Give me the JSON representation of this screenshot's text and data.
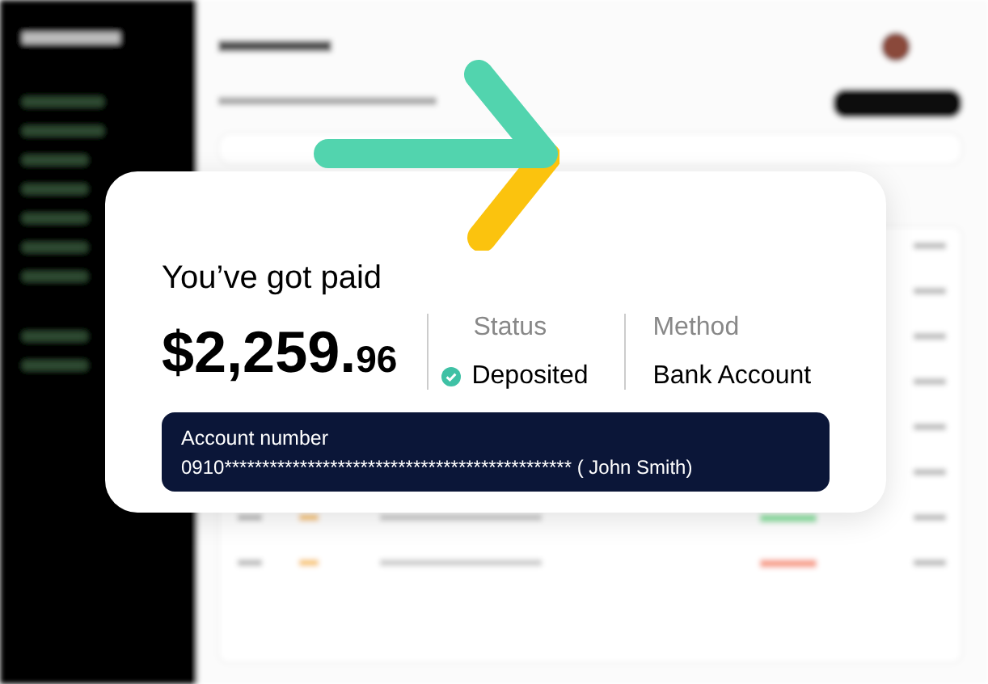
{
  "payment": {
    "title": "You’ve got paid",
    "amount": "$2,259.",
    "cents": "96",
    "status": {
      "label": "Status",
      "value": "Deposited"
    },
    "method": {
      "label": "Method",
      "value": "Bank Account"
    },
    "account": {
      "label": "Account number",
      "number": "0910********************************************** ( John Smith)"
    }
  }
}
